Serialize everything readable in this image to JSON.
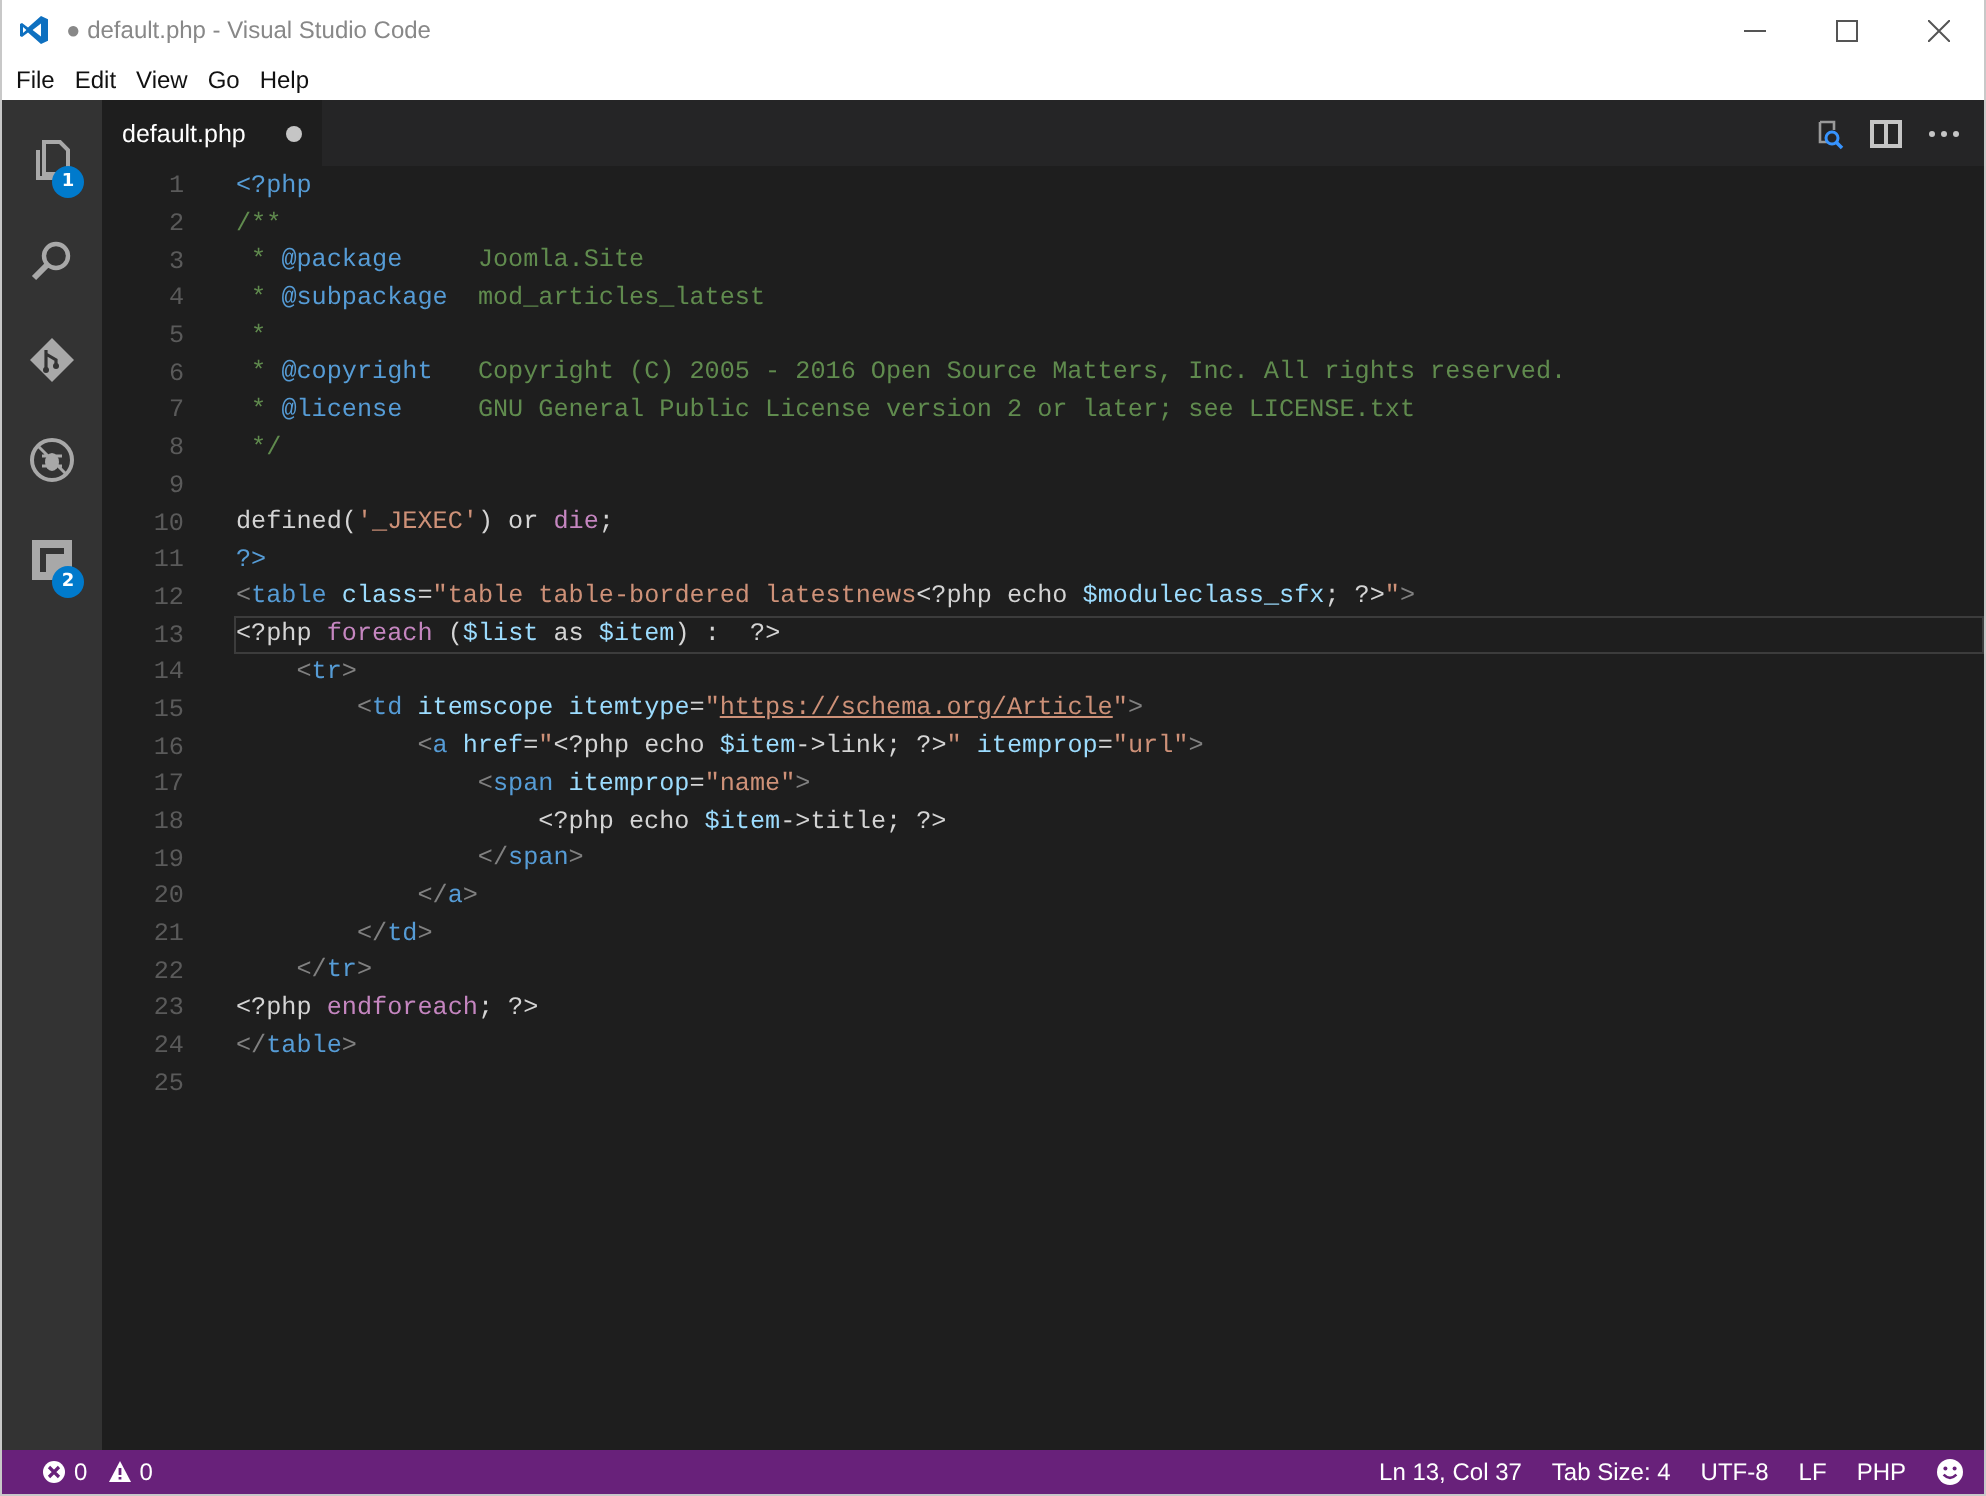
{
  "window": {
    "title": "● default.php - Visual Studio Code"
  },
  "menu": [
    "File",
    "Edit",
    "View",
    "Go",
    "Help"
  ],
  "activity_bar": [
    {
      "kind": "files",
      "badge": "1"
    },
    {
      "kind": "search"
    },
    {
      "kind": "git"
    },
    {
      "kind": "debug"
    },
    {
      "kind": "extensions",
      "badge": "2"
    }
  ],
  "tabs": [
    {
      "label": "default.php",
      "selected": true,
      "dirty": true
    }
  ],
  "editor": {
    "lines": [
      {
        "number": "1",
        "current": false,
        "tokens": [
          {
            "text": "<?php",
            "kind": "tag"
          }
        ]
      },
      {
        "number": "2",
        "current": false,
        "tokens": [
          {
            "text": "/**",
            "kind": "comment"
          }
        ]
      },
      {
        "number": "3",
        "current": false,
        "tokens": [
          {
            "text": " * ",
            "kind": "comment"
          },
          {
            "text": "@package",
            "kind": "doctag"
          },
          {
            "text": "     Joomla.Site",
            "kind": "comment"
          }
        ]
      },
      {
        "number": "4",
        "current": false,
        "tokens": [
          {
            "text": " * ",
            "kind": "comment"
          },
          {
            "text": "@subpackage",
            "kind": "doctag"
          },
          {
            "text": "  mod_articles_latest",
            "kind": "comment"
          }
        ]
      },
      {
        "number": "5",
        "current": false,
        "tokens": [
          {
            "text": " *",
            "kind": "comment"
          }
        ]
      },
      {
        "number": "6",
        "current": false,
        "tokens": [
          {
            "text": " * ",
            "kind": "comment"
          },
          {
            "text": "@copyright",
            "kind": "doctag"
          },
          {
            "text": "   Copyright (C) 2005 - 2016 Open Source Matters, Inc. All rights reserved.",
            "kind": "comment"
          }
        ]
      },
      {
        "number": "7",
        "current": false,
        "tokens": [
          {
            "text": " * ",
            "kind": "comment"
          },
          {
            "text": "@license",
            "kind": "doctag"
          },
          {
            "text": "     GNU General Public License version 2 or later; see LICENSE.txt",
            "kind": "comment"
          }
        ]
      },
      {
        "number": "8",
        "current": false,
        "tokens": [
          {
            "text": " */",
            "kind": "comment"
          }
        ]
      },
      {
        "number": "9",
        "current": false
      },
      {
        "number": "10",
        "current": false,
        "tokens": [
          {
            "text": "defined(",
            "kind": "plain"
          },
          {
            "text": "'_JEXEC'",
            "kind": "string"
          },
          {
            "text": ") or ",
            "kind": "plain"
          },
          {
            "text": "die",
            "kind": "keyword"
          },
          {
            "text": ";",
            "kind": "plain"
          }
        ]
      },
      {
        "number": "11",
        "current": false,
        "tokens": [
          {
            "text": "?>",
            "kind": "tag"
          }
        ]
      },
      {
        "number": "12",
        "current": false,
        "tokens": [
          {
            "text": "<",
            "kind": "bracket"
          },
          {
            "text": "table",
            "kind": "tag"
          },
          {
            "text": " class",
            "kind": "attr"
          },
          {
            "text": "=",
            "kind": "plain"
          },
          {
            "text": "\"table table-bordered latestnews",
            "kind": "string"
          },
          {
            "text": "<?php echo ",
            "kind": "plain"
          },
          {
            "text": "$moduleclass_sfx",
            "kind": "variable"
          },
          {
            "text": "; ?>",
            "kind": "plain"
          },
          {
            "text": "\"",
            "kind": "string"
          },
          {
            "text": ">",
            "kind": "bracket"
          }
        ]
      },
      {
        "number": "13",
        "current": true,
        "tokens": [
          {
            "text": "<?php ",
            "kind": "plain"
          },
          {
            "text": "foreach",
            "kind": "keyword"
          },
          {
            "text": " (",
            "kind": "plain"
          },
          {
            "text": "$list",
            "kind": "variable"
          },
          {
            "text": " as ",
            "kind": "plain"
          },
          {
            "text": "$item",
            "kind": "variable"
          },
          {
            "text": ") :  ?>",
            "kind": "plain"
          }
        ]
      },
      {
        "number": "14",
        "current": false,
        "tokens": [
          {
            "text": "    <",
            "kind": "bracket"
          },
          {
            "text": "tr",
            "kind": "tag"
          },
          {
            "text": ">",
            "kind": "bracket"
          }
        ]
      },
      {
        "number": "15",
        "current": false,
        "tokens": [
          {
            "text": "        <",
            "kind": "bracket"
          },
          {
            "text": "td",
            "kind": "tag"
          },
          {
            "text": " itemscope itemtype",
            "kind": "attr"
          },
          {
            "text": "=",
            "kind": "plain"
          },
          {
            "text": "\"",
            "kind": "string"
          },
          {
            "text": "https://schema.org/Article",
            "kind": "link"
          },
          {
            "text": "\"",
            "kind": "string"
          },
          {
            "text": ">",
            "kind": "bracket"
          }
        ]
      },
      {
        "number": "16",
        "current": false,
        "tokens": [
          {
            "text": "            <",
            "kind": "bracket"
          },
          {
            "text": "a",
            "kind": "tag"
          },
          {
            "text": " href",
            "kind": "attr"
          },
          {
            "text": "=",
            "kind": "plain"
          },
          {
            "text": "\"",
            "kind": "string"
          },
          {
            "text": "<?php echo ",
            "kind": "plain"
          },
          {
            "text": "$item",
            "kind": "variable"
          },
          {
            "text": "->link; ?>",
            "kind": "plain"
          },
          {
            "text": "\"",
            "kind": "string"
          },
          {
            "text": " itemprop",
            "kind": "attr"
          },
          {
            "text": "=",
            "kind": "plain"
          },
          {
            "text": "\"url\"",
            "kind": "string"
          },
          {
            "text": ">",
            "kind": "bracket"
          }
        ]
      },
      {
        "number": "17",
        "current": false,
        "tokens": [
          {
            "text": "                <",
            "kind": "bracket"
          },
          {
            "text": "span",
            "kind": "tag"
          },
          {
            "text": " itemprop",
            "kind": "attr"
          },
          {
            "text": "=",
            "kind": "plain"
          },
          {
            "text": "\"name\"",
            "kind": "string"
          },
          {
            "text": ">",
            "kind": "bracket"
          }
        ]
      },
      {
        "number": "18",
        "current": false,
        "tokens": [
          {
            "text": "                    <?php echo ",
            "kind": "plain"
          },
          {
            "text": "$item",
            "kind": "variable"
          },
          {
            "text": "->title; ?>",
            "kind": "plain"
          }
        ]
      },
      {
        "number": "19",
        "current": false,
        "tokens": [
          {
            "text": "                </",
            "kind": "bracket"
          },
          {
            "text": "span",
            "kind": "tag"
          },
          {
            "text": ">",
            "kind": "bracket"
          }
        ]
      },
      {
        "number": "20",
        "current": false,
        "tokens": [
          {
            "text": "            </",
            "kind": "bracket"
          },
          {
            "text": "a",
            "kind": "tag"
          },
          {
            "text": ">",
            "kind": "bracket"
          }
        ]
      },
      {
        "number": "21",
        "current": false,
        "tokens": [
          {
            "text": "        </",
            "kind": "bracket"
          },
          {
            "text": "td",
            "kind": "tag"
          },
          {
            "text": ">",
            "kind": "bracket"
          }
        ]
      },
      {
        "number": "22",
        "current": false,
        "tokens": [
          {
            "text": "    </",
            "kind": "bracket"
          },
          {
            "text": "tr",
            "kind": "tag"
          },
          {
            "text": ">",
            "kind": "bracket"
          }
        ]
      },
      {
        "number": "23",
        "current": false,
        "tokens": [
          {
            "text": "<?php ",
            "kind": "plain"
          },
          {
            "text": "endforeach",
            "kind": "keyword"
          },
          {
            "text": "; ?>",
            "kind": "plain"
          }
        ]
      },
      {
        "number": "24",
        "current": false,
        "tokens": [
          {
            "text": "</",
            "kind": "bracket"
          },
          {
            "text": "table",
            "kind": "tag"
          },
          {
            "text": ">",
            "kind": "bracket"
          }
        ]
      },
      {
        "number": "25",
        "current": false
      }
    ]
  },
  "status_bar": {
    "errors": "0",
    "warnings": "0",
    "items": [
      "Ln 13, Col 37",
      "Tab Size: 4",
      "UTF-8",
      "LF",
      "PHP"
    ]
  }
}
